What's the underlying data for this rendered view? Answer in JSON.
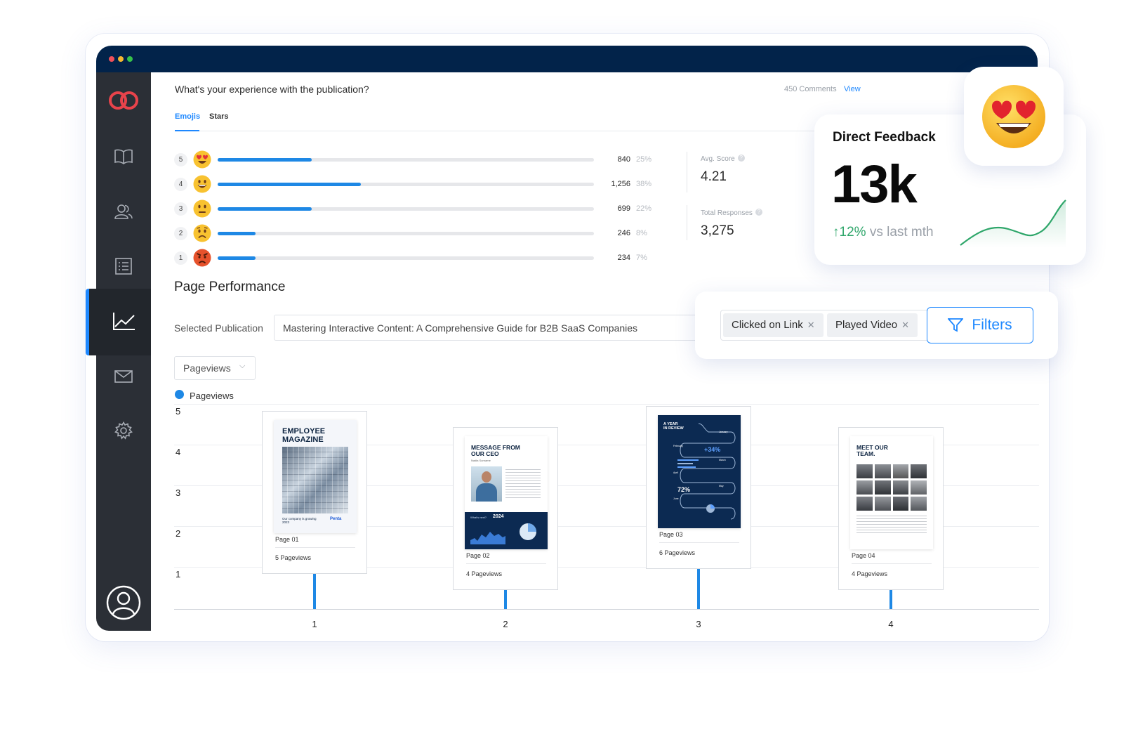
{
  "feedback": {
    "question": "What's your experience with the publication?",
    "comments_count": "450 Comments",
    "comments_link": "View",
    "tabs": [
      "Emojis",
      "Stars"
    ],
    "active_tab": "Emojis",
    "ratings": [
      {
        "score": "5",
        "emoji": "heart-eyes-emoji",
        "count": "840",
        "pct": "25%",
        "fraction": 0.25
      },
      {
        "score": "4",
        "emoji": "smile-emoji",
        "count": "1,256",
        "pct": "38%",
        "fraction": 0.38
      },
      {
        "score": "3",
        "emoji": "neutral-emoji",
        "count": "699",
        "pct": "22%",
        "fraction": 0.25
      },
      {
        "score": "2",
        "emoji": "frown-emoji",
        "count": "246",
        "pct": "8%",
        "fraction": 0.1
      },
      {
        "score": "1",
        "emoji": "angry-emoji",
        "count": "234",
        "pct": "7%",
        "fraction": 0.1
      }
    ],
    "avg_score_label": "Avg. Score",
    "avg_score": "4.21",
    "total_responses_label": "Total Responses",
    "total_responses": "3,275"
  },
  "direct_feedback": {
    "title": "Direct Feedback",
    "value": "13k",
    "change": "12%",
    "change_suffix": "vs last mth",
    "accent": "#2ea66a"
  },
  "page_performance": {
    "title": "Page Performance",
    "selected_label": "Selected Publication",
    "selected_value": "Mastering Interactive Content: A Comprehensive Guide for B2B SaaS Companies",
    "metric": "Pageviews",
    "filters": [
      "Clicked on Link",
      "Played Video"
    ],
    "filters_button": "Filters"
  },
  "chart_data": {
    "type": "bar",
    "legend": "Pageviews",
    "categories": [
      "1",
      "2",
      "3",
      "4"
    ],
    "values": [
      5,
      4,
      6,
      4
    ],
    "yticks": [
      "5",
      "4",
      "3",
      "2",
      "1"
    ],
    "pages": [
      {
        "label": "Page 01",
        "views": "5 Pageviews",
        "thumb_lines": [
          "EMPLOYEE",
          "MAGAZINE"
        ],
        "thumb_foot": "Our company is growing",
        "thumb_year": "2023",
        "thumb_brand": "Penta"
      },
      {
        "label": "Page 02",
        "views": "4 Pageviews",
        "thumb_lines": [
          "MESSAGE FROM",
          "OUR CEO"
        ],
        "thumb_name": "Nadia Surname",
        "thumb_box": "What's next?",
        "thumb_year": "2024"
      },
      {
        "label": "Page 03",
        "views": "6 Pageviews",
        "thumb_lines": [
          "A YEAR",
          "IN REVIEW"
        ],
        "thumb_months": [
          "January",
          "February",
          "March",
          "April",
          "May",
          "June"
        ],
        "thumb_stat1": "+34%",
        "thumb_stat2": "72%"
      },
      {
        "label": "Page 04",
        "views": "4 Pageviews",
        "thumb_lines": [
          "MEET OUR",
          "TEAM."
        ]
      }
    ]
  },
  "colors": {
    "accent": "#1e88e5",
    "titlebar": "#02234a",
    "sidebar": "#2b2f36",
    "brand": "#e8434b"
  }
}
